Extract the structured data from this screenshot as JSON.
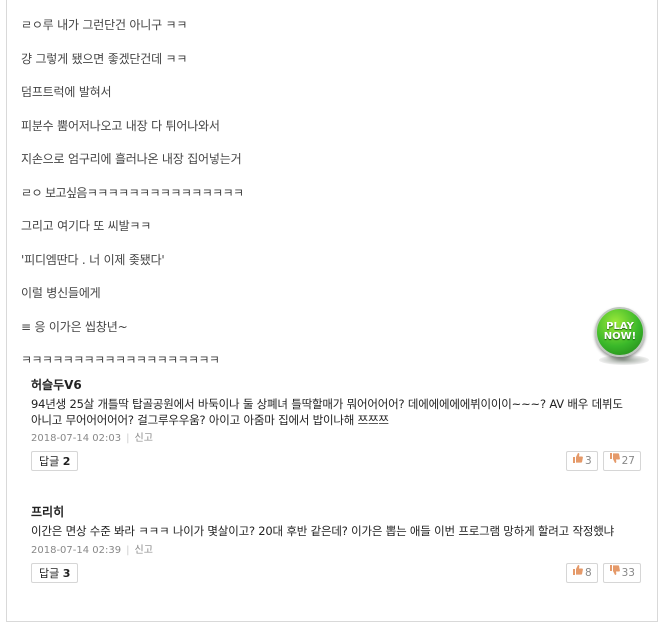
{
  "post": {
    "lines": [
      "ㄹㅇ루 내가 그런단건 아니구 ㅋㅋ",
      "걍 그렇게 됐으면 좋겠단건데 ㅋㅋ",
      "덤프트럭에 발혀서",
      "피분수 뿜어저나오고 내장 다 튀어나와서",
      "지손으로 엄구리에 흘러나온 내장 집어넣는거",
      "ㄹㅇ 보고싶음ㅋㅋㅋㅋㅋㅋㅋㅋㅋㅋㅋㅋㅋㅋㅋ",
      "그리고 여기다 또 씨발ㅋㅋ",
      "'피디엠딴다 . 너 이제 좆됐다'",
      "이럴 병신들에게",
      "≡ 응 이가은 씹창년~",
      "ㅋㅋㅋㅋㅋㅋㅋㅋㅋㅋㅋㅋㅋㅋㅋㅋㅋㅋㅋ"
    ]
  },
  "ad": {
    "line1": "PLAY",
    "line2": "NOW!"
  },
  "comments": [
    {
      "nickname": "허슬두V6",
      "text": "94년생 25살 개틀딱 탑골공원에서 바둑이나 둘 상폐녀 틀딱할매가 뭐어어어어? 데에에에에에뷔이이이~~~? AV 배우 데뷔도 아니고 무어어어어어? 걸그루우우움? 아이고 아줌마 집에서 밥이나해 쯔쯔쯔",
      "date": "2018-07-14 02:03",
      "report": "신고",
      "reply_label": "답글",
      "reply_count": "2",
      "like_icon": "thumbs-up",
      "likes": "3",
      "dislike_icon": "thumbs-down",
      "dislikes": "27"
    },
    {
      "nickname": "프리히",
      "text": "이간은 면상 수준 봐라 ㅋㅋㅋ 나이가 몇살이고? 20대 후반 같은데? 이가은 뽑는 애들 이번 프로그램 망하게 할려고 작정했냐",
      "date": "2018-07-14 02:39",
      "report": "신고",
      "reply_label": "답글",
      "reply_count": "3",
      "like_icon": "thumbs-up",
      "likes": "8",
      "dislike_icon": "thumbs-down",
      "dislikes": "33"
    }
  ]
}
